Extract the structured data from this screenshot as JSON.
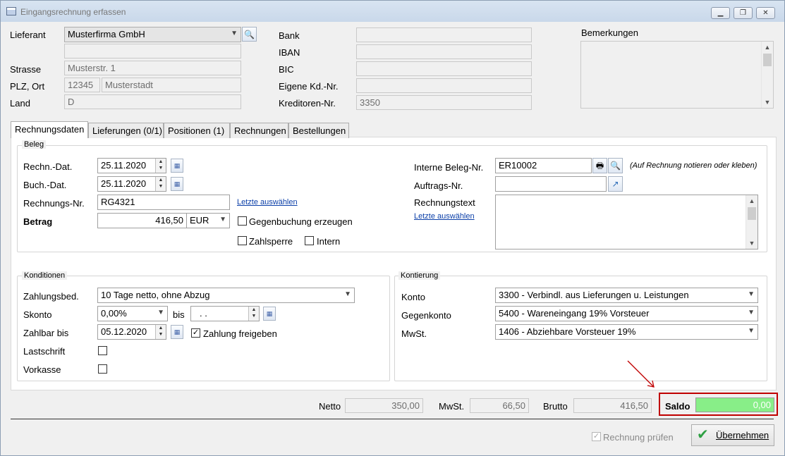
{
  "window": {
    "title": "Eingangsrechnung erfassen"
  },
  "supplier": {
    "lieferant_label": "Lieferant",
    "lieferant_value": "Musterfirma GmbH",
    "strasse_label": "Strasse",
    "strasse_value": "Musterstr. 1",
    "plz_ort_label": "PLZ, Ort",
    "plz_value": "12345",
    "ort_value": "Musterstadt",
    "land_label": "Land",
    "land_value": "D"
  },
  "bank": {
    "bank_label": "Bank",
    "iban_label": "IBAN",
    "bic_label": "BIC",
    "eigene_label": "Eigene Kd.-Nr.",
    "kreditoren_label": "Kreditoren-Nr.",
    "kreditoren_value": "3350"
  },
  "bemerkungen_label": "Bemerkungen",
  "tabs": [
    {
      "label": "Rechnungsdaten"
    },
    {
      "label": "Lieferungen (0/1)"
    },
    {
      "label": "Positionen (1)"
    },
    {
      "label": "Rechnungen"
    },
    {
      "label": "Bestellungen"
    }
  ],
  "beleg": {
    "group_title": "Beleg",
    "rechn_dat_label": "Rechn.-Dat.",
    "rechn_dat_value": "25.11.2020",
    "buch_dat_label": "Buch.-Dat.",
    "buch_dat_value": "25.11.2020",
    "rechnungs_nr_label": "Rechnungs-Nr.",
    "rechnungs_nr_value": "RG4321",
    "letzte_link": "Letzte auswählen",
    "betrag_label": "Betrag",
    "betrag_value": "416,50",
    "currency": "EUR",
    "gegenbuchung_label": "Gegenbuchung erzeugen",
    "zahlsperre_label": "Zahlsperre",
    "intern_label": "Intern",
    "interne_beleg_label": "Interne Beleg-Nr.",
    "interne_beleg_value": "ER10002",
    "beleg_hint": "(Auf Rechnung notieren oder kleben)",
    "auftrags_label": "Auftrags-Nr.",
    "rechnungstext_label": "Rechnungstext",
    "letzte_link2": "Letzte auswählen"
  },
  "konditionen": {
    "group_title": "Konditionen",
    "zahlungsbed_label": "Zahlungsbed.",
    "zahlungsbed_value": "10 Tage netto, ohne Abzug",
    "skonto_label": "Skonto",
    "skonto_value": "0,00%",
    "bis_label": "bis",
    "bis_value": ". .",
    "zahlbar_label": "Zahlbar bis",
    "zahlbar_value": "05.12.2020",
    "zahlung_freigeben_label": "Zahlung freigeben",
    "zahlung_freigeben_checked": true,
    "lastschrift_label": "Lastschrift",
    "vorkasse_label": "Vorkasse"
  },
  "kontierung": {
    "group_title": "Kontierung",
    "konto_label": "Konto",
    "konto_value": "3300 - Verbindl. aus Lieferungen u. Leistungen",
    "gegenkonto_label": "Gegenkonto",
    "gegenkonto_value": "5400 - Wareneingang 19% Vorsteuer",
    "mwst_label": "MwSt.",
    "mwst_value": "1406 - Abziehbare Vorsteuer 19%"
  },
  "totals": {
    "netto_label": "Netto",
    "netto_value": "350,00",
    "mwst_label": "MwSt.",
    "mwst_value": "66,50",
    "brutto_label": "Brutto",
    "brutto_value": "416,50",
    "saldo_label": "Saldo",
    "saldo_value": "0,00"
  },
  "footer": {
    "rechnung_pruefen_label": "Rechnung prüfen",
    "uebernehmen_label": "Übernehmen"
  },
  "colors": {
    "saldo_bg": "#88ee88",
    "highlight_border": "#c00000",
    "link": "#0b3fa8"
  }
}
